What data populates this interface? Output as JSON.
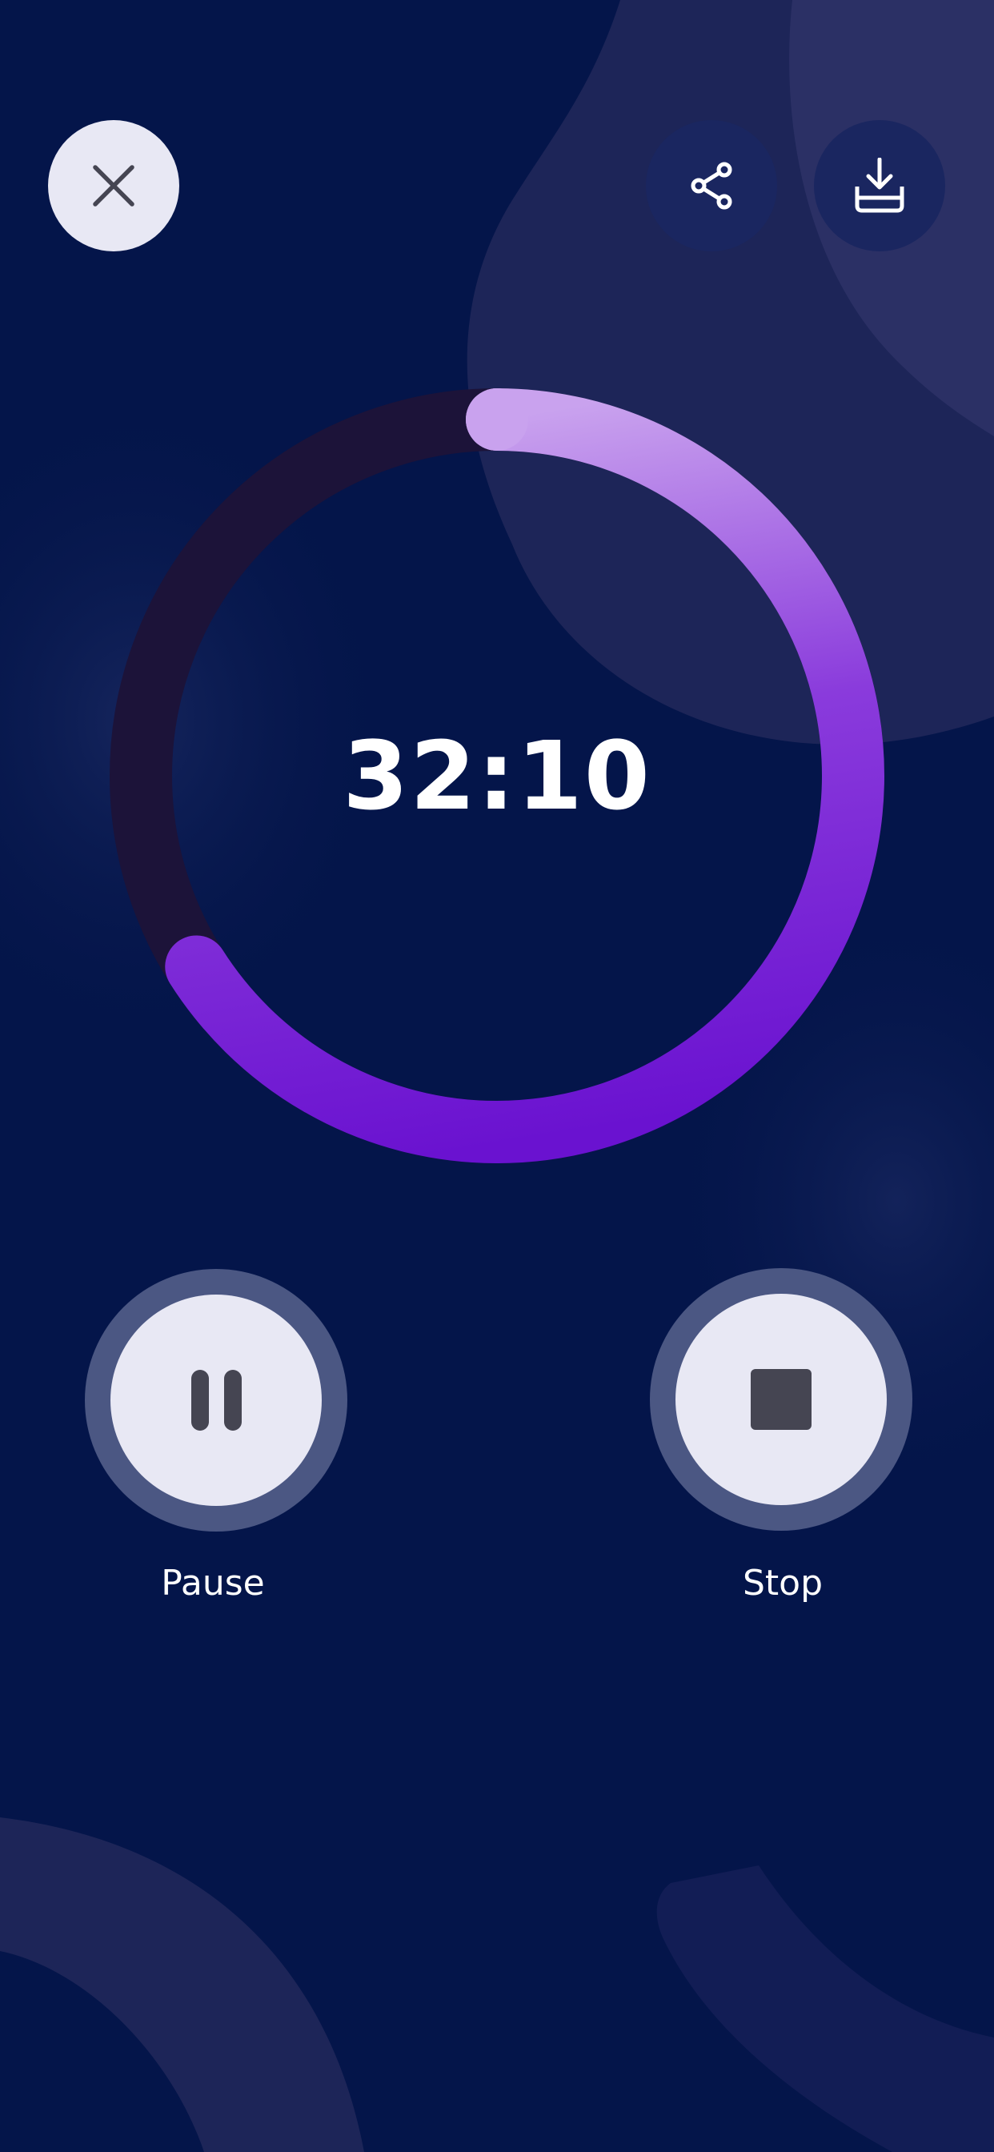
{
  "header": {
    "close_icon": "close-icon",
    "share_icon": "share-icon",
    "download_icon": "download-icon"
  },
  "timer": {
    "time": "32:10",
    "progress": 0.66
  },
  "controls": {
    "pause_label": "Pause",
    "pause_icon": "pause-icon",
    "stop_label": "Stop",
    "stop_icon": "stop-icon"
  },
  "colors": {
    "background": "#04154a",
    "accent_start": "#c9a2ee",
    "accent_end": "#6a12d0",
    "track": "#1c1339",
    "button_light": "#e8e8f4",
    "button_dark": "#1a2660"
  }
}
